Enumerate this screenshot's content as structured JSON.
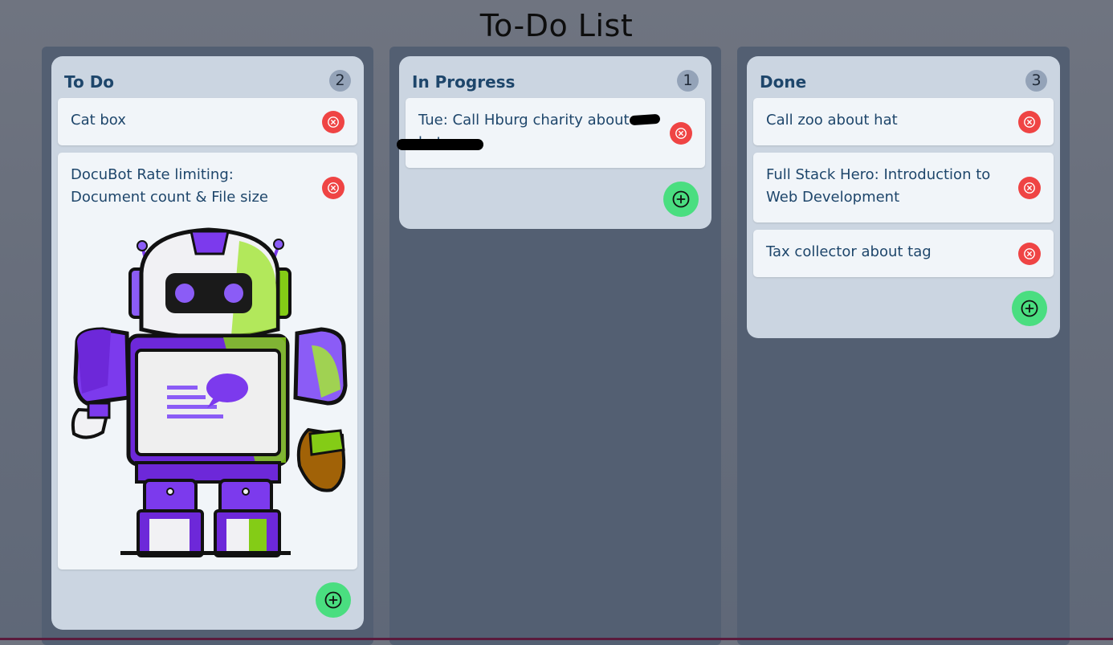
{
  "header": {
    "title": "To-Do List"
  },
  "columns": [
    {
      "title": "To Do",
      "count": "2",
      "cards": [
        {
          "text": "Cat box"
        },
        {
          "text": "DocuBot Rate limiting: Document count & File size",
          "image": "robot-illustration"
        }
      ]
    },
    {
      "title": "In Progress",
      "count": "1",
      "cards": [
        {
          "text": "Tue: Call Hburg charity about hat"
        }
      ]
    },
    {
      "title": "Done",
      "count": "3",
      "cards": [
        {
          "text": "Call zoo about hat"
        },
        {
          "text": "Full Stack Hero: Introduction to Web Development"
        },
        {
          "text": "Tax collector about tag"
        }
      ]
    }
  ],
  "icons": {
    "delete": "close-circle-icon",
    "add": "plus-circle-icon"
  },
  "colors": {
    "delete_button": "#ef4444",
    "add_button": "#4ade80",
    "column_title": "#1e466b",
    "panel": "#cbd5e1",
    "card": "#f1f5f9"
  }
}
